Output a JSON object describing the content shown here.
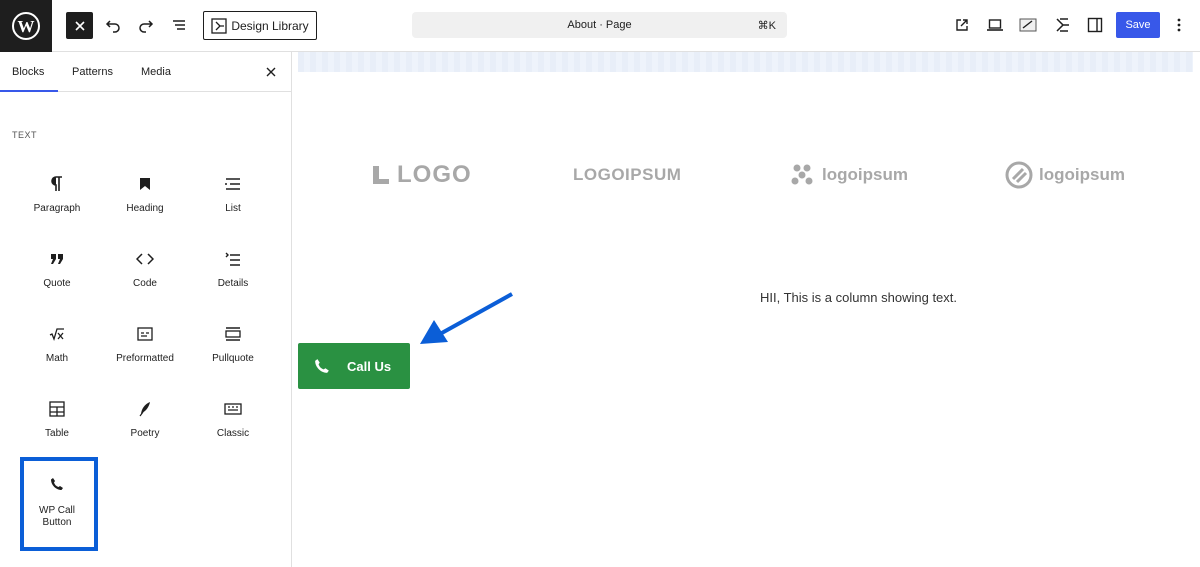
{
  "topbar": {
    "design_library_label": "Design Library",
    "document_title": "About · Page",
    "shortcut": "⌘K",
    "save_label": "Save"
  },
  "sidebar": {
    "tabs": [
      "Blocks",
      "Patterns",
      "Media"
    ],
    "section_label": "TEXT",
    "blocks": [
      {
        "label": "Paragraph",
        "icon": "paragraph-icon"
      },
      {
        "label": "Heading",
        "icon": "heading-icon"
      },
      {
        "label": "List",
        "icon": "list-icon"
      },
      {
        "label": "Quote",
        "icon": "quote-icon"
      },
      {
        "label": "Code",
        "icon": "code-icon"
      },
      {
        "label": "Details",
        "icon": "details-icon"
      },
      {
        "label": "Math",
        "icon": "math-icon"
      },
      {
        "label": "Preformatted",
        "icon": "preformatted-icon"
      },
      {
        "label": "Pullquote",
        "icon": "pullquote-icon"
      },
      {
        "label": "Table",
        "icon": "table-icon"
      },
      {
        "label": "Poetry",
        "icon": "poetry-icon"
      },
      {
        "label": "Classic",
        "icon": "classic-icon"
      },
      {
        "label_line1": "WP Call",
        "label_line2": "Button",
        "icon": "phone-icon"
      }
    ]
  },
  "canvas": {
    "logos": [
      "LOGO",
      "LOGOIPSUM",
      "logoipsum",
      "logoipsum"
    ],
    "column_text": "HII, This is a column showing text.",
    "call_button_label": "Call Us",
    "accent_colors": {
      "call_button": "#2a9142",
      "highlight": "#0b5ed7",
      "save": "#3858e9"
    }
  }
}
